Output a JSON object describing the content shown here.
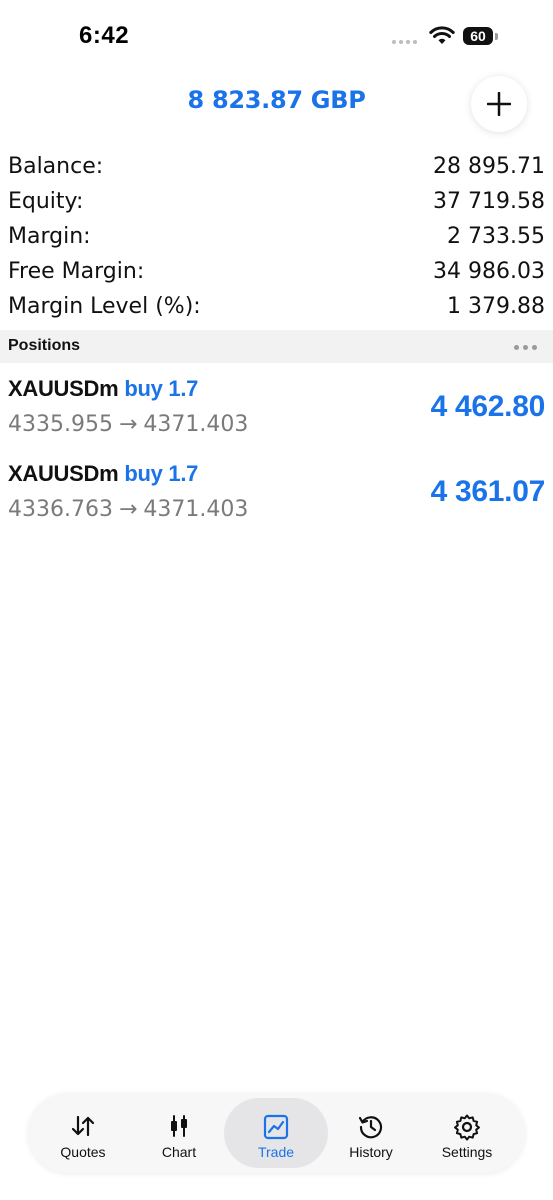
{
  "status_bar": {
    "time": "6:42",
    "battery": "60"
  },
  "header": {
    "total_profit": "8 823.87 GBP"
  },
  "summary": [
    {
      "label": "Balance:",
      "value": "28 895.71"
    },
    {
      "label": "Equity:",
      "value": "37 719.58"
    },
    {
      "label": "Margin:",
      "value": "2 733.55"
    },
    {
      "label": "Free Margin:",
      "value": "34 986.03"
    },
    {
      "label": "Margin Level (%):",
      "value": "1 379.88"
    }
  ],
  "positions": {
    "title": "Positions",
    "items": [
      {
        "symbol": "XAUUSDm",
        "side": "buy 1.7",
        "open_price": "4335.955",
        "arrow": "→",
        "current_price": "4371.403",
        "profit": "4 462.80"
      },
      {
        "symbol": "XAUUSDm",
        "side": "buy 1.7",
        "open_price": "4336.763",
        "arrow": "→",
        "current_price": "4371.403",
        "profit": "4 361.07"
      }
    ]
  },
  "tabs": [
    {
      "label": "Quotes",
      "icon": "quotes-icon"
    },
    {
      "label": "Chart",
      "icon": "chart-icon"
    },
    {
      "label": "Trade",
      "icon": "trade-icon",
      "active": true
    },
    {
      "label": "History",
      "icon": "history-icon"
    },
    {
      "label": "Settings",
      "icon": "gear-icon"
    }
  ],
  "colors": {
    "accent": "#1a73e8",
    "muted_text": "#7a7a7a",
    "section_bg": "#f2f2f3"
  }
}
